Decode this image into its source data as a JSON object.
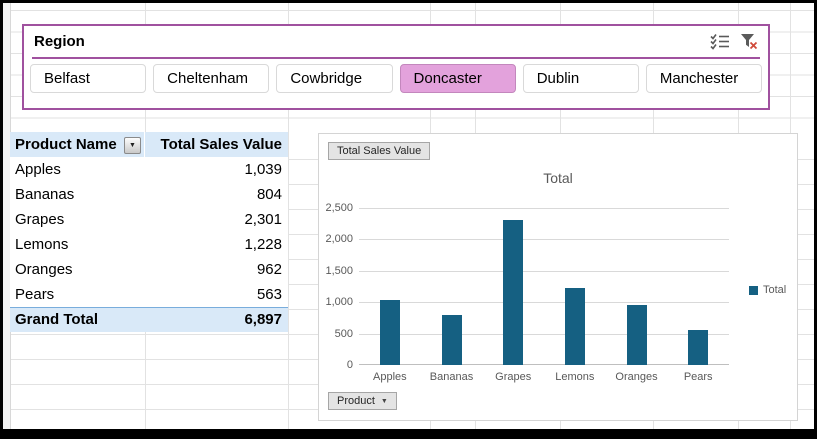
{
  "slicer": {
    "title": "Region",
    "items": [
      {
        "label": "Belfast",
        "selected": false
      },
      {
        "label": "Cheltenham",
        "selected": false
      },
      {
        "label": "Cowbridge",
        "selected": false
      },
      {
        "label": "Doncaster",
        "selected": true
      },
      {
        "label": "Dublin",
        "selected": false
      },
      {
        "label": "Manchester",
        "selected": false
      }
    ],
    "border_color": "#A0519F",
    "selected_fill": "#E3A2DC"
  },
  "pivot_table": {
    "header": {
      "product": "Product Name",
      "value": "Total Sales Value"
    },
    "rows": [
      {
        "product": "Apples",
        "value": "1,039"
      },
      {
        "product": "Bananas",
        "value": "804"
      },
      {
        "product": "Grapes",
        "value": "2,301"
      },
      {
        "product": "Lemons",
        "value": "1,228"
      },
      {
        "product": "Oranges",
        "value": "962"
      },
      {
        "product": "Pears",
        "value": "563"
      }
    ],
    "grand_total": {
      "product": "Grand Total",
      "value": "6,897"
    },
    "header_bg": "#D9E9F8"
  },
  "chart_data": {
    "type": "bar",
    "title": "Total",
    "categories": [
      "Apples",
      "Bananas",
      "Grapes",
      "Lemons",
      "Oranges",
      "Pears"
    ],
    "series": [
      {
        "name": "Total",
        "values": [
          1039,
          804,
          2301,
          1228,
          962,
          563
        ]
      }
    ],
    "ylim": [
      0,
      2500
    ],
    "yticks": [
      "0",
      "500",
      "1,000",
      "1,500",
      "2,000",
      "2,500"
    ],
    "grid": true,
    "legend_position": "right",
    "bar_color": "#156082",
    "field_buttons": {
      "value": "Total Sales Value",
      "axis": "Product"
    }
  },
  "icons": {
    "multi_select": "multi-select-icon",
    "clear_filter": "clear-filter-icon",
    "header_dropdown": "▼",
    "axis_dropdown": "▼"
  }
}
